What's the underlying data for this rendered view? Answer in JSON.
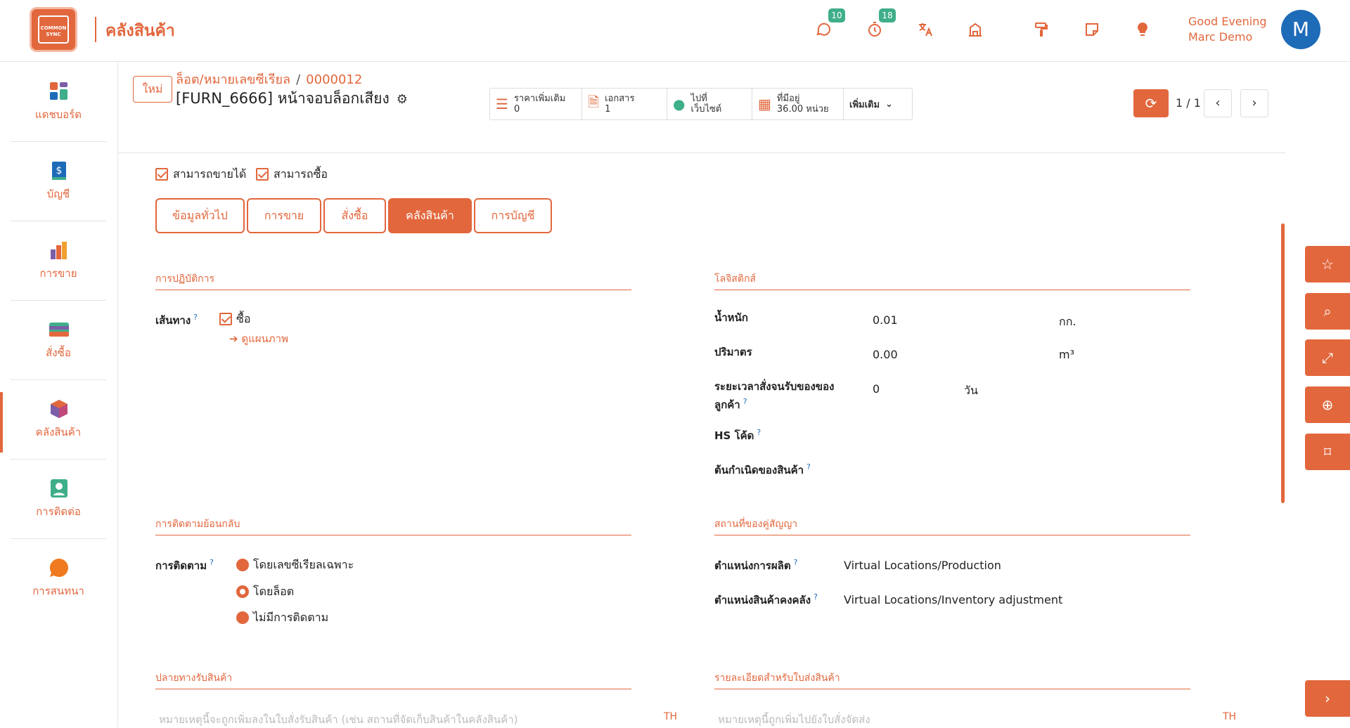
{
  "app": {
    "logo_text": "COMMON SYNC",
    "title": "คลังสินค้า",
    "greeting_line1": "Good Evening",
    "greeting_line2": "Marc Demo",
    "avatar_initial": "M",
    "accent_color": "#e2673d"
  },
  "topbar": {
    "icons": [
      {
        "name": "chat-icon",
        "glyph": "💬",
        "badge": "10"
      },
      {
        "name": "timer-icon",
        "glyph": "⏱",
        "badge": "18"
      },
      {
        "name": "translate-icon",
        "glyph": "文",
        "badge": ""
      },
      {
        "name": "building-icon",
        "glyph": "🏛",
        "badge": ""
      },
      {
        "name": "paint-roller-icon",
        "glyph": "🖌",
        "badge": ""
      },
      {
        "name": "note-icon",
        "glyph": "🗒",
        "badge": ""
      },
      {
        "name": "lightbulb-icon",
        "glyph": "💡",
        "badge": ""
      }
    ]
  },
  "sidebar": {
    "items": [
      {
        "label": "แดชบอร์ด"
      },
      {
        "label": "บัญชี"
      },
      {
        "label": "การขาย"
      },
      {
        "label": "สั่งซื้อ"
      },
      {
        "label": "คลังสินค้า"
      },
      {
        "label": "การติดต่อ"
      },
      {
        "label": "การสนทนา"
      }
    ]
  },
  "header": {
    "new_label": "ใหม่",
    "breadcrumb_parent": "ล็อต/หมายเลขซีเรียล",
    "breadcrumb_sep": "/",
    "breadcrumb_current": "0000012",
    "record_title": "[FURN_6666] หน้าจอบล็อกเสียง",
    "gear_glyph": "⚙"
  },
  "stats": {
    "extra_price_label": "ราคาเพิ่มเติม",
    "extra_price_value": "0",
    "documents_label": "เอกสาร",
    "documents_value": "1",
    "website_line1": "ไปที่",
    "website_line2": "เว็บไซต์",
    "on_hand_label": "ที่มีอยู่",
    "on_hand_value": "36.00 หน่วย",
    "more_label": "เพิ่มเติม"
  },
  "pager": {
    "count": "1 / 1",
    "prev": "‹",
    "next": "›",
    "refresh": "⟳"
  },
  "checkboxes": {
    "can_sell": "สามารถขายได้",
    "can_buy": "สามารถซื้อ"
  },
  "tabs": [
    {
      "label": "ข้อมูลทั่วไป",
      "active": false
    },
    {
      "label": "การขาย",
      "active": false
    },
    {
      "label": "สั่งซื้อ",
      "active": false
    },
    {
      "label": "คลังสินค้า",
      "active": true
    },
    {
      "label": "การบัญชี",
      "active": false
    }
  ],
  "operations": {
    "title": "การปฏิบัติการ",
    "routes_label": "เส้นทาง",
    "route_buy": "ซื้อ",
    "view_diagram": "ดูแผนภาพ"
  },
  "logistics": {
    "title": "โลจิสติกส์",
    "weight_label": "น้ำหนัก",
    "weight_value": "0.01",
    "weight_unit": "กก.",
    "volume_label": "ปริมาตร",
    "volume_value": "0.00",
    "volume_unit": "m³",
    "lead_label_line1": "ระยะเวลาสั่งจนรับของของ",
    "lead_label_line2": "ลูกค้า",
    "lead_value": "0",
    "lead_unit": "วัน",
    "hs_label": "HS โค้ด",
    "origin_label": "ต้นกำเนิดของสินค้า"
  },
  "traceability": {
    "title": "การติดตามย้อนกลับ",
    "tracking_label": "การติดตาม",
    "options": [
      {
        "label": "โดยเลขซีเรียลเฉพาะ",
        "selected": false
      },
      {
        "label": "โดยล็อต",
        "selected": true
      },
      {
        "label": "ไม่มีการติดตาม",
        "selected": false
      }
    ]
  },
  "counterpart": {
    "title": "สถานที่ของคู่สัญญา",
    "production_label": "ตำแหน่งการผลิต",
    "production_value": "Virtual Locations/Production",
    "inventory_label": "ตำแหน่งสินค้าคงคลัง",
    "inventory_value": "Virtual Locations/Inventory adjustment"
  },
  "receipts": {
    "title": "ปลายทางรับสินค้า",
    "placeholder": "หมายเหตุนี้จะถูกเพิ่มลงในใบสั่งรับสินค้า (เช่น สถานที่จัดเก็บสินค้าในคลังสินค้า)",
    "lang": "TH"
  },
  "delivery": {
    "title": "รายละเอียดสำหรับใบส่งสินค้า",
    "placeholder": "หมายเหตุนี้ถูกเพิ่มไปยังใบสั่งจัดส่ง",
    "lang": "TH"
  },
  "float_buttons": [
    {
      "name": "star-icon",
      "glyph": "☆"
    },
    {
      "name": "search-icon",
      "glyph": "⌕"
    },
    {
      "name": "expand-icon",
      "glyph": "⤢"
    },
    {
      "name": "zoom-in-icon",
      "glyph": "⊕"
    },
    {
      "name": "bookmark-icon",
      "glyph": "⌑"
    },
    {
      "name": "chevron-right-icon",
      "glyph": "›"
    }
  ]
}
